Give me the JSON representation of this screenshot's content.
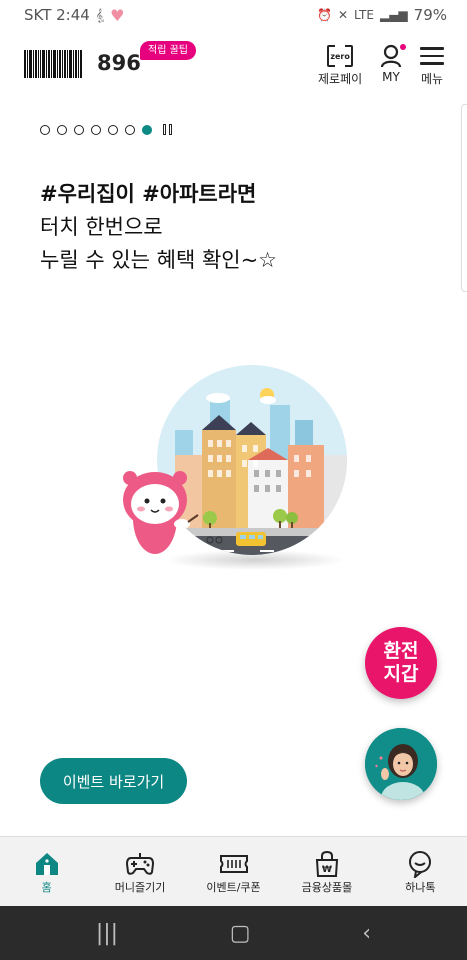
{
  "status_bar": {
    "carrier_time": "SKT 2:44",
    "battery": "79%"
  },
  "header": {
    "points": "896",
    "tip_badge": "적립 꿀팁",
    "zeropay_label": "제로페이",
    "zeropay_icon_text": "zero",
    "my_label": "MY",
    "menu_label": "메뉴"
  },
  "carousel": {
    "total_slides": 7,
    "active_slide": 7
  },
  "banner": {
    "title": "#우리집이 #아파트라면",
    "line1": "터치 한번으로",
    "line2": "누릴 수 있는 혜택 확인~☆"
  },
  "floating": {
    "exchange_line1": "환전",
    "exchange_line2": "지갑",
    "event_button": "이벤트 바로가기"
  },
  "bottom_nav": {
    "items": [
      {
        "label": "홈",
        "icon": "home-icon",
        "active": true
      },
      {
        "label": "머니즐기기",
        "icon": "gamepad-icon",
        "active": false
      },
      {
        "label": "이벤트/쿠폰",
        "icon": "ticket-icon",
        "active": false
      },
      {
        "label": "금융상품몰",
        "icon": "shopping-bag-icon",
        "active": false
      },
      {
        "label": "하나톡",
        "icon": "chat-bubble-icon",
        "active": false
      }
    ]
  },
  "colors": {
    "accent_teal": "#0d8783",
    "brand_pink": "#e8156b"
  }
}
